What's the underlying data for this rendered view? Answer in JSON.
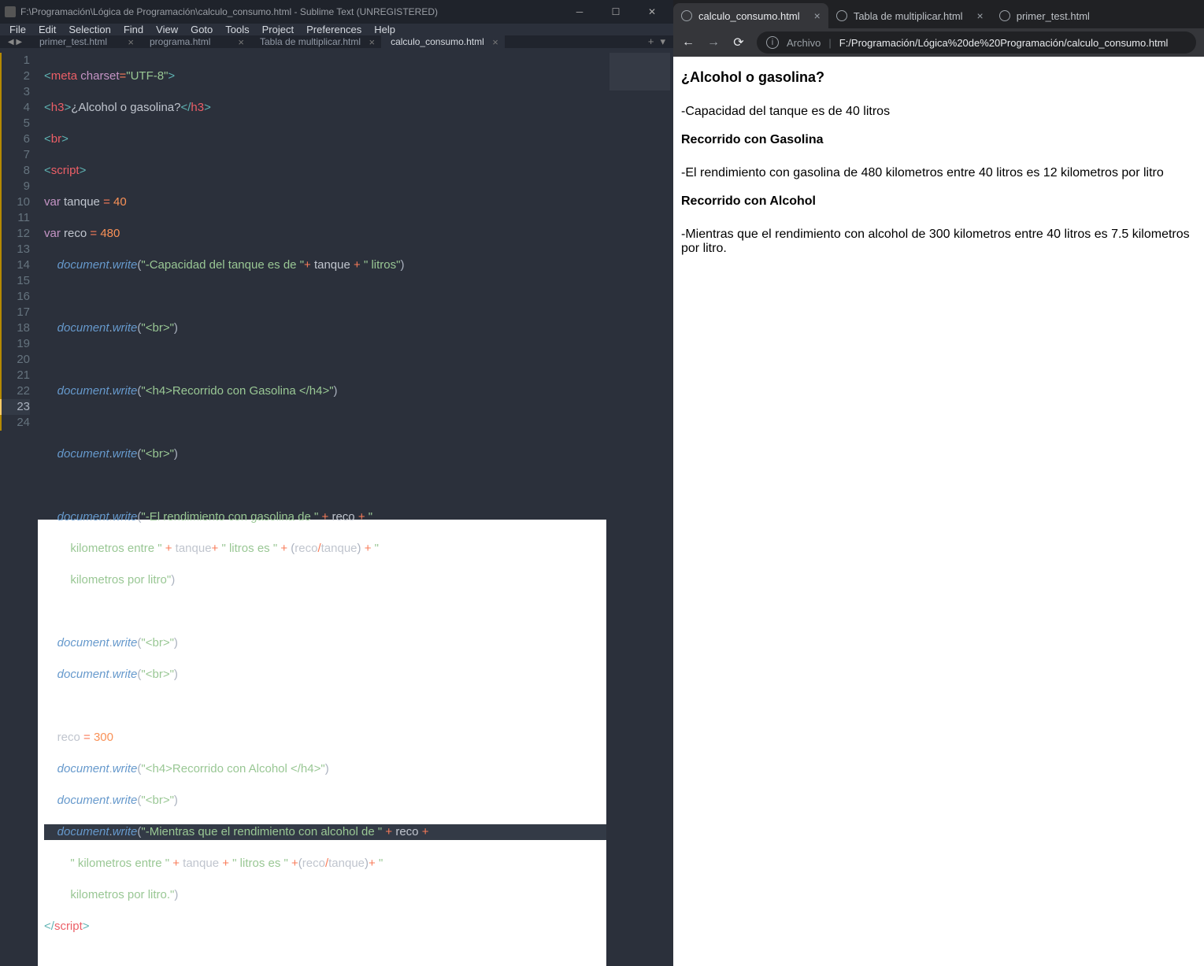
{
  "sublime": {
    "title": "F:\\Programación\\Lógica de Programación\\calculo_consumo.html - Sublime Text (UNREGISTERED)",
    "menu": [
      "File",
      "Edit",
      "Selection",
      "Find",
      "View",
      "Goto",
      "Tools",
      "Project",
      "Preferences",
      "Help"
    ],
    "tabs": [
      {
        "label": "primer_test.html",
        "active": false
      },
      {
        "label": "programa.html",
        "active": false
      },
      {
        "label": "Tabla de multiplicar.html",
        "active": false
      },
      {
        "label": "calculo_consumo.html",
        "active": true
      }
    ],
    "highlight_line": 23,
    "lines_count": 24
  },
  "chrome": {
    "tabs": [
      {
        "label": "calculo_consumo.html",
        "active": true,
        "closable": true
      },
      {
        "label": "Tabla de multiplicar.html",
        "active": false,
        "closable": true
      },
      {
        "label": "primer_test.html",
        "active": false,
        "closable": false
      }
    ],
    "url_label": "Archivo",
    "url_path": "F:/Programación/Lógica%20de%20Programación/calculo_consumo.html"
  },
  "page": {
    "h3": "¿Alcohol o gasolina?",
    "cap": "-Capacidad del tanque es de 40 litros",
    "h4a": "Recorrido con Gasolina",
    "txt_a": "-El rendimiento con gasolina de 480 kilometros entre 40 litros es 12 kilometros por litro",
    "h4b": "Recorrido con Alcohol",
    "txt_b": "-Mientras que el rendimiento con alcohol de 300 kilometros entre 40 litros es 7.5 kilometros por litro."
  }
}
